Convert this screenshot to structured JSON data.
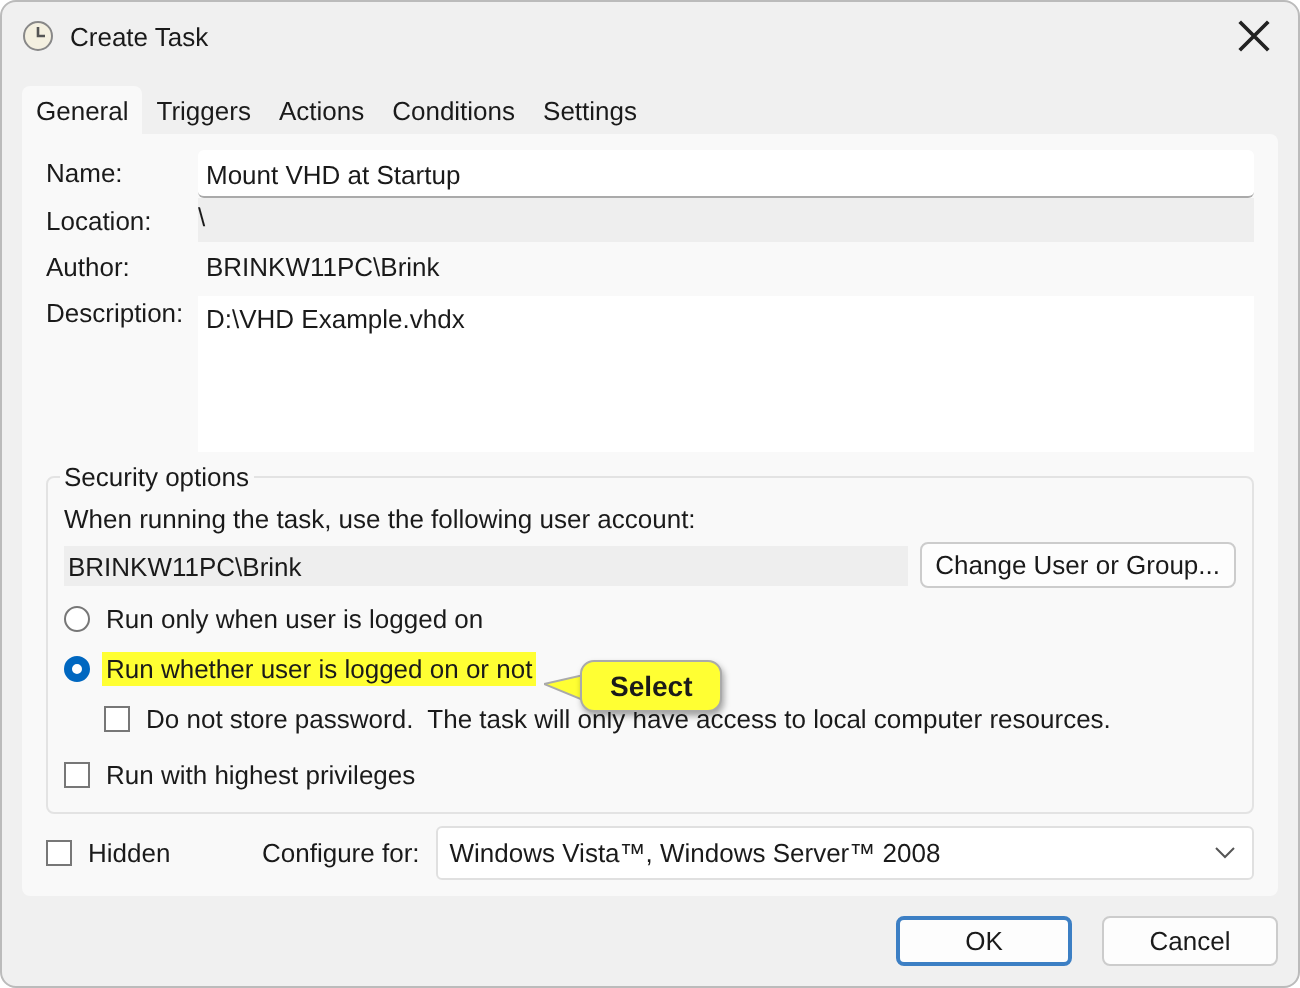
{
  "window": {
    "title": "Create Task"
  },
  "tabs": [
    {
      "label": "General",
      "selected": true
    },
    {
      "label": "Triggers",
      "selected": false
    },
    {
      "label": "Actions",
      "selected": false
    },
    {
      "label": "Conditions",
      "selected": false
    },
    {
      "label": "Settings",
      "selected": false
    }
  ],
  "fields": [
    {
      "kind": "input",
      "label": "Name:",
      "value": "Mount VHD at Startup"
    },
    {
      "kind": "readonly",
      "label": "Location:",
      "value": "\\"
    },
    {
      "kind": "text",
      "label": "Author:",
      "value": "BRINKW11PC\\Brink"
    },
    {
      "kind": "textarea",
      "label": "Description:",
      "value": "D:\\VHD Example.vhdx"
    }
  ],
  "security": {
    "title": "Security options",
    "account_prompt": "When running the task, use the following user account:",
    "account": "BRINKW11PC\\Brink",
    "change_button": "Change User or Group...",
    "options": [
      {
        "kind": "radio",
        "label": "Run only when user is logged on",
        "selected": false,
        "highlighted": false
      },
      {
        "kind": "radio",
        "label": "Run whether user is logged on or not",
        "selected": true,
        "highlighted": true,
        "children": [
          {
            "kind": "checkbox",
            "label": "Do not store password.  The task will only have access to local computer resources.",
            "checked": false,
            "highlighted": false
          }
        ]
      },
      {
        "kind": "checkbox",
        "label": "Run with highest privileges",
        "checked": false,
        "highlighted": false
      }
    ]
  },
  "callout": {
    "text": "Select"
  },
  "hidden": {
    "label": "Hidden",
    "checked": false
  },
  "configure": {
    "label": "Configure for:",
    "value": "Windows Vista™, Windows Server™ 2008"
  },
  "buttons": [
    {
      "label": "OK",
      "default": true
    },
    {
      "label": "Cancel",
      "default": false
    }
  ]
}
